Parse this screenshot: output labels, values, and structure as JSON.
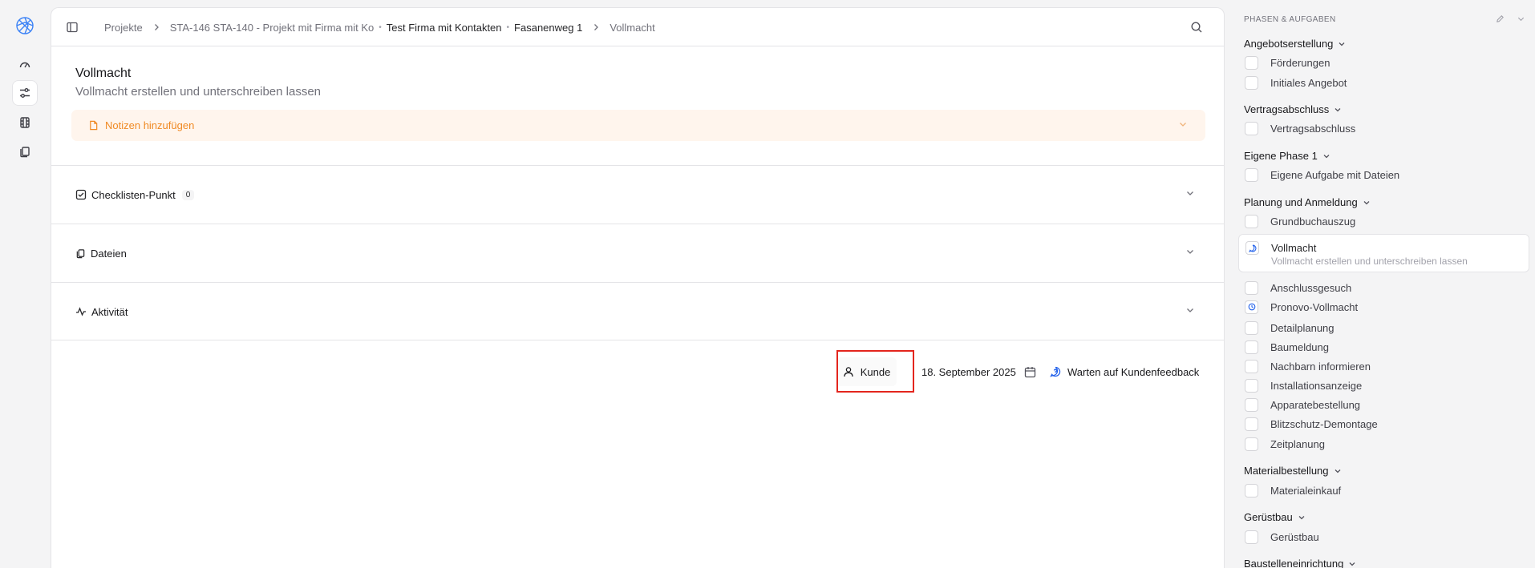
{
  "breadcrumb": {
    "projekte": "Projekte",
    "project": "STA-146 STA-140 - Projekt mit Firma mit Ko",
    "company": "Test Firma mit Kontakten",
    "address": "Fasanenweg 1",
    "current": "Vollmacht"
  },
  "task": {
    "title": "Vollmacht",
    "subtitle": "Vollmacht erstellen und unterschreiben lassen",
    "notes_label": "Notizen hinzufügen"
  },
  "sections": {
    "checklist_label": "Checklisten-Punkt",
    "checklist_count": "0",
    "files_label": "Dateien",
    "activity_label": "Aktivität"
  },
  "footer": {
    "assignee": "Kunde",
    "date": "18. September 2025",
    "status": "Warten auf Kundenfeedback"
  },
  "phases_panel": {
    "heading": "PHASEN & AUFGABEN",
    "phases": [
      {
        "label": "Angebotserstellung",
        "tasks": [
          "Förderungen",
          "Initiales Angebot"
        ]
      },
      {
        "label": "Vertragsabschluss",
        "tasks": [
          "Vertragsabschluss"
        ]
      },
      {
        "label": "Eigene Phase 1",
        "tasks": [
          "Eigene Aufgabe mit Dateien"
        ]
      },
      {
        "label": "Planung und Anmeldung",
        "tasks": [
          "Grundbuchauszug",
          "Vollmacht",
          "Anschlussgesuch",
          "Pronovo-Vollmacht",
          "Detailplanung",
          "Baumeldung",
          "Nachbarn informieren",
          "Installationsanzeige",
          "Apparatebestellung",
          "Blitzschutz-Demontage",
          "Zeitplanung"
        ]
      },
      {
        "label": "Materialbestellung",
        "tasks": [
          "Materialeinkauf"
        ]
      },
      {
        "label": "Gerüstbau",
        "tasks": [
          "Gerüstbau"
        ]
      },
      {
        "label": "Baustelleneinrichtung",
        "tasks": []
      }
    ],
    "active_task_subtitle": "Vollmacht erstellen und unterschreiben lassen"
  },
  "colors": {
    "accent": "#2563eb",
    "notes_bg": "#fff5ed",
    "notes_text": "#f08a24",
    "highlight": "#e3251d"
  }
}
